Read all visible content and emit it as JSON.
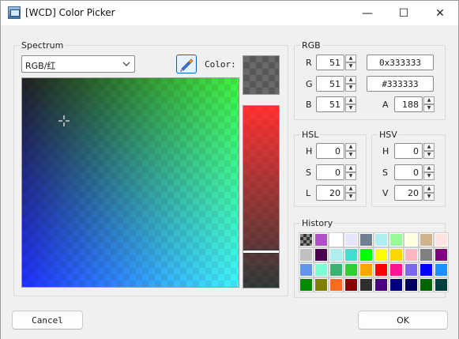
{
  "window": {
    "title": "[WCD] Color Picker",
    "minimize_glyph": "—",
    "maximize_glyph": "☐",
    "close_glyph": "✕"
  },
  "spectrum": {
    "group_label": "Spectrum",
    "mode_select_value": "RGB/红",
    "color_label": "Color:"
  },
  "rgb": {
    "group_label": "RGB",
    "r_label": "R",
    "r_value": "51",
    "g_label": "G",
    "g_value": "51",
    "b_label": "B",
    "b_value": "51",
    "a_label": "A",
    "a_value": "188",
    "hex_value": "0x333333",
    "html_value": "#333333"
  },
  "hsl": {
    "group_label": "HSL",
    "h_label": "H",
    "h_value": "0",
    "s_label": "S",
    "s_value": "0",
    "l_label": "L",
    "l_value": "20"
  },
  "hsv": {
    "group_label": "HSV",
    "h_label": "H",
    "h_value": "0",
    "s_label": "S",
    "s_value": "0",
    "v_label": "V",
    "v_value": "20"
  },
  "history": {
    "group_label": "History",
    "colors": [
      "checker-dark",
      "#b050c8",
      "#ffffff",
      "#e6e6fa",
      "#708090",
      "#afeeee",
      "#98fb98",
      "#ffffe0",
      "#d2b48c",
      "#ffe4e1",
      "#c0c0c0",
      "#4b0050",
      "#afeeee",
      "#40e0d0",
      "#00ff00",
      "#ffff00",
      "#ffd700",
      "#ffb6c1",
      "#808080",
      "#800080",
      "#6495ed",
      "#7fffd4",
      "#3cb371",
      "#32cd32",
      "#ffa500",
      "#ff0000",
      "#ff1493",
      "#7b68ee",
      "#0000ff",
      "#1e90ff",
      "#008b00",
      "#808000",
      "#ff6820",
      "#8b0000",
      "#2f2f2f",
      "#4b0082",
      "#000080",
      "#000060",
      "#006400",
      "#004040"
    ]
  },
  "footer": {
    "cancel_label": "Cancel",
    "ok_label": "OK"
  },
  "current_color": {
    "hex": "#333333",
    "alpha": 188
  }
}
